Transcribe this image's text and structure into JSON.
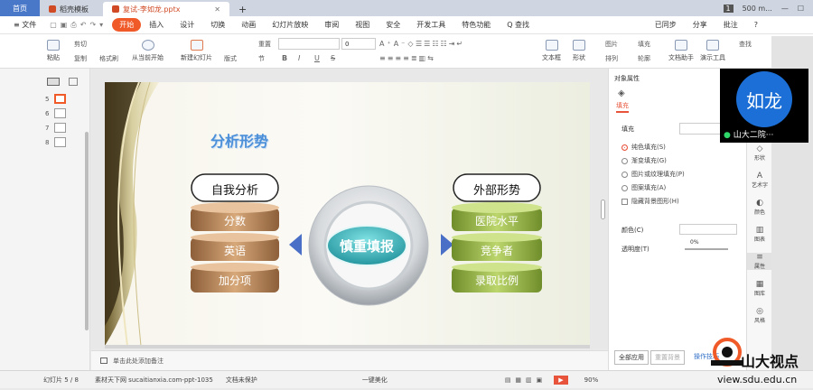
{
  "tabs": {
    "home": "首页",
    "t1": "稻壳模板",
    "t2": "复试-李如龙.pptx",
    "plus": "+",
    "badge": "1",
    "user": "500 m..."
  },
  "menu": {
    "file": "≡ 文件",
    "start": "开始",
    "items": [
      "插入",
      "设计",
      "切换",
      "动画",
      "幻灯片放映",
      "审阅",
      "视图",
      "安全",
      "开发工具",
      "特色功能"
    ],
    "search": "Q 查找",
    "sync": "已同步",
    "share": "分享",
    "comment": "批注",
    "help": "?"
  },
  "toolbar": {
    "paste": "粘贴",
    "cut": "剪切",
    "copy": "复制",
    "format_painter": "格式刷",
    "play_current": "从当前开始",
    "new_slide": "新建幻灯片",
    "layout": "版式",
    "section": "节",
    "reset": "重置",
    "font_size": "0",
    "textbox": "文本框",
    "shape": "形状",
    "arrange": "排列",
    "picture": "图片",
    "fill": "填充",
    "outline": "轮廓",
    "doc_helper": "文档助手",
    "presenter": "演示工具",
    "find": "查找",
    "bold": "B",
    "italic": "I",
    "underline": "U",
    "strike": "S"
  },
  "left_panel": {
    "slides": [
      "5",
      "6",
      "7",
      "8"
    ]
  },
  "slide": {
    "title": "分析形势",
    "left_label": "自我分析",
    "left_items": [
      "分数",
      "英语",
      "加分项"
    ],
    "center_label": "慎重填报",
    "right_label": "外部形势",
    "right_items": [
      "医院水平",
      "竞争者",
      "录取比例"
    ]
  },
  "notes": {
    "text": "单击此处添加备注"
  },
  "right_panel": {
    "header": "对象属性",
    "fill_tab": "填充",
    "section": "填充",
    "options": [
      "纯色填充(S)",
      "渐变填充(G)",
      "图片或纹理填充(P)",
      "图案填充(A)"
    ],
    "hide_bg": "隐藏背景图形(H)",
    "color_label": "颜色(C)",
    "transparency_label": "透明度(T)",
    "transparency_value": "0%",
    "apply_all": "全部应用",
    "reset_bg": "重置背景",
    "op_tip": "操作技巧"
  },
  "right_sidebar": [
    "形状",
    "艺术字",
    "颜色",
    "图表",
    "属性",
    "图库",
    "风格"
  ],
  "status": {
    "slide": "幻灯片 5 / 8",
    "template": "素材天下网 sucaitianxia.com-ppt-1035",
    "protect": "文档未保护",
    "beautify": "一键美化",
    "zoom": "90%"
  },
  "video": {
    "avatar_text": "如龙",
    "name": "山大二院···"
  },
  "watermark": {
    "brand": "山大视点",
    "url": "view.sdu.edu.cn"
  },
  "colors": {
    "accent": "#f05a28",
    "tab_blue": "#4a78c9",
    "cylinder_left": "#b48159",
    "cylinder_right": "#93b443",
    "center": "#2ba9b0"
  }
}
